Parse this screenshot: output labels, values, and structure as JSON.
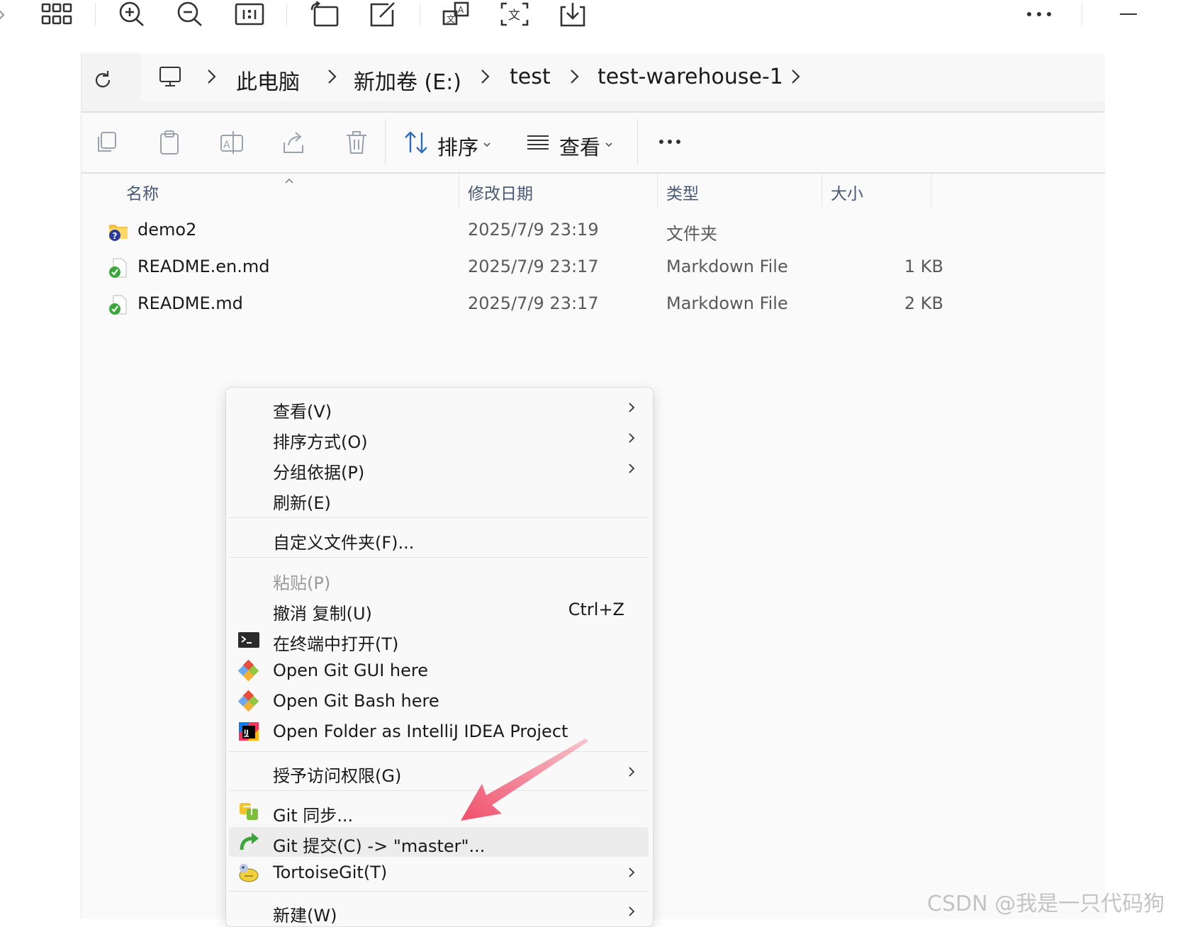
{
  "toolbar": {
    "icons": [
      "back-arrow-icon",
      "grid-icon",
      "zoom-in-icon",
      "zoom-out-icon",
      "actual-size-icon",
      "rotate-icon",
      "edit-icon",
      "translate-icon",
      "ocr-icon",
      "save-icon",
      "more-icon",
      "minimize-icon"
    ]
  },
  "breadcrumb": [
    "此电脑",
    "新加卷 (E:)",
    "test",
    "test-warehouse-1"
  ],
  "command_bar": {
    "sort_label": "排序",
    "view_label": "查看"
  },
  "columns": {
    "name": "名称",
    "date": "修改日期",
    "type": "类型",
    "size": "大小"
  },
  "files": [
    {
      "name": "demo2",
      "date": "2025/7/9 23:19",
      "type": "文件夹",
      "size": "",
      "icon": "folder-unversioned-icon"
    },
    {
      "name": "README.en.md",
      "date": "2025/7/9 23:17",
      "type": "Markdown File",
      "size": "1 KB",
      "icon": "file-committed-icon"
    },
    {
      "name": "README.md",
      "date": "2025/7/9 23:17",
      "type": "Markdown File",
      "size": "2 KB",
      "icon": "file-committed-icon"
    }
  ],
  "context_menu": {
    "view": "查看(V)",
    "sort_by": "排序方式(O)",
    "group_by": "分组依据(P)",
    "refresh": "刷新(E)",
    "customize": "自定义文件夹(F)...",
    "paste": "粘贴(P)",
    "undo": "撤消 复制(U)",
    "undo_shortcut": "Ctrl+Z",
    "terminal": "在终端中打开(T)",
    "git_gui": "Open Git GUI here",
    "git_bash": "Open Git Bash here",
    "intellij": "Open Folder as IntelliJ IDEA Project",
    "grant_access": "授予访问权限(G)",
    "git_sync": "Git 同步...",
    "git_commit": "Git 提交(C) -> \"master\"...",
    "tortoise": "TortoiseGit(T)",
    "new": "新建(W)"
  },
  "colors": {
    "annotation_arrow": "#f04e6a",
    "git_orange": "#f05133",
    "ok_green": "#3aa63a",
    "accent_blue": "#2d6cc0"
  },
  "watermark": "CSDN @我是一只代码狗"
}
